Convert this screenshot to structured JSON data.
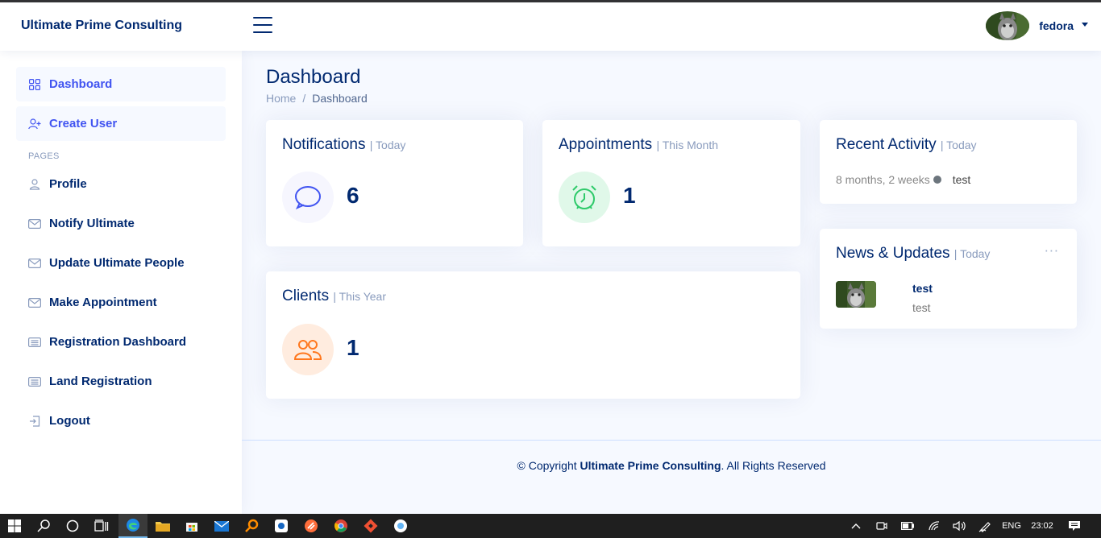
{
  "header": {
    "brand": "Ultimate Prime Consulting",
    "user_name": "fedora"
  },
  "sidebar": {
    "items": [
      {
        "label": "Dashboard",
        "icon": "grid-icon"
      },
      {
        "label": "Create User",
        "icon": "person-plus-icon"
      }
    ],
    "pages_heading": "PAGES",
    "pages": [
      {
        "label": "Profile",
        "icon": "person-icon"
      },
      {
        "label": "Notify Ultimate",
        "icon": "envelope-icon"
      },
      {
        "label": "Update Ultimate People",
        "icon": "envelope-icon"
      },
      {
        "label": "Make Appointment",
        "icon": "envelope-icon"
      },
      {
        "label": "Registration Dashboard",
        "icon": "card-list-icon"
      },
      {
        "label": "Land Registration",
        "icon": "card-list-icon"
      },
      {
        "label": "Logout",
        "icon": "box-arrow-in-left-icon"
      }
    ]
  },
  "main": {
    "title": "Dashboard",
    "breadcrumb": [
      "Home",
      "Dashboard"
    ],
    "cards": {
      "notifications": {
        "title": "Notifications",
        "sub": "| Today",
        "value": "6",
        "icon": "chat-icon"
      },
      "appointments": {
        "title": "Appointments",
        "sub": "| This Month",
        "value": "1",
        "icon": "alarm-icon"
      },
      "clients": {
        "title": "Clients",
        "sub": "| This Year",
        "value": "1",
        "icon": "people-icon"
      },
      "recent_activity": {
        "title": "Recent Activity",
        "sub": "| Today",
        "time": "8 months, 2 weeks",
        "text": "test"
      },
      "news": {
        "title": "News & Updates",
        "sub": "| Today",
        "item_title": "test",
        "item_text": "test"
      }
    }
  },
  "footer": {
    "prefix": "© Copyright ",
    "company": "Ultimate Prime Consulting",
    "suffix": ". All Rights Reserved"
  },
  "taskbar": {
    "lang": "ENG",
    "time": "23:02"
  },
  "colors": {
    "primary": "#012970",
    "accent": "#4154f1",
    "green": "#2eca6a",
    "orange": "#ff771d"
  }
}
